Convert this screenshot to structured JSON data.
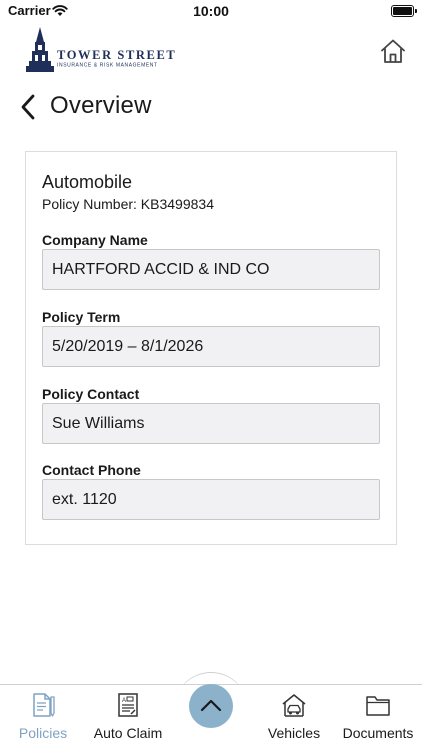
{
  "status_bar": {
    "carrier": "Carrier",
    "time": "10:00",
    "battery_level": 1.0
  },
  "header": {
    "logo_line1": "TOWER STREET",
    "logo_line2": "INSURANCE & RISK MANAGEMENT",
    "home_icon": "home-icon"
  },
  "page": {
    "title": "Overview",
    "back_icon": "chevron-left-icon"
  },
  "policy": {
    "type": "Automobile",
    "number_text": "Policy Number: KB3499834",
    "fields": [
      {
        "label": "Company Name",
        "value": "HARTFORD ACCID & IND CO"
      },
      {
        "label": "Policy Term",
        "value": "5/20/2019 – 8/1/2026"
      },
      {
        "label": "Policy Contact",
        "value": "Sue Williams"
      },
      {
        "label": "Contact Phone",
        "value": "ext. 1120"
      }
    ]
  },
  "tab_bar": {
    "tabs": [
      {
        "label": "Policies",
        "icon": "policy-document-icon",
        "active": true
      },
      {
        "label": "Auto Claim",
        "icon": "claim-form-icon",
        "active": false
      },
      {
        "label": "Vehicles",
        "icon": "garage-car-icon",
        "active": false
      },
      {
        "label": "Documents",
        "icon": "folder-icon",
        "active": false
      }
    ],
    "center_button_icon": "chevron-up-icon"
  },
  "colors": {
    "accent": "#8bb1cb",
    "active_tab": "#7fa2c2",
    "logo_navy": "#1f2f5a",
    "field_bg": "#f1f1f3"
  }
}
